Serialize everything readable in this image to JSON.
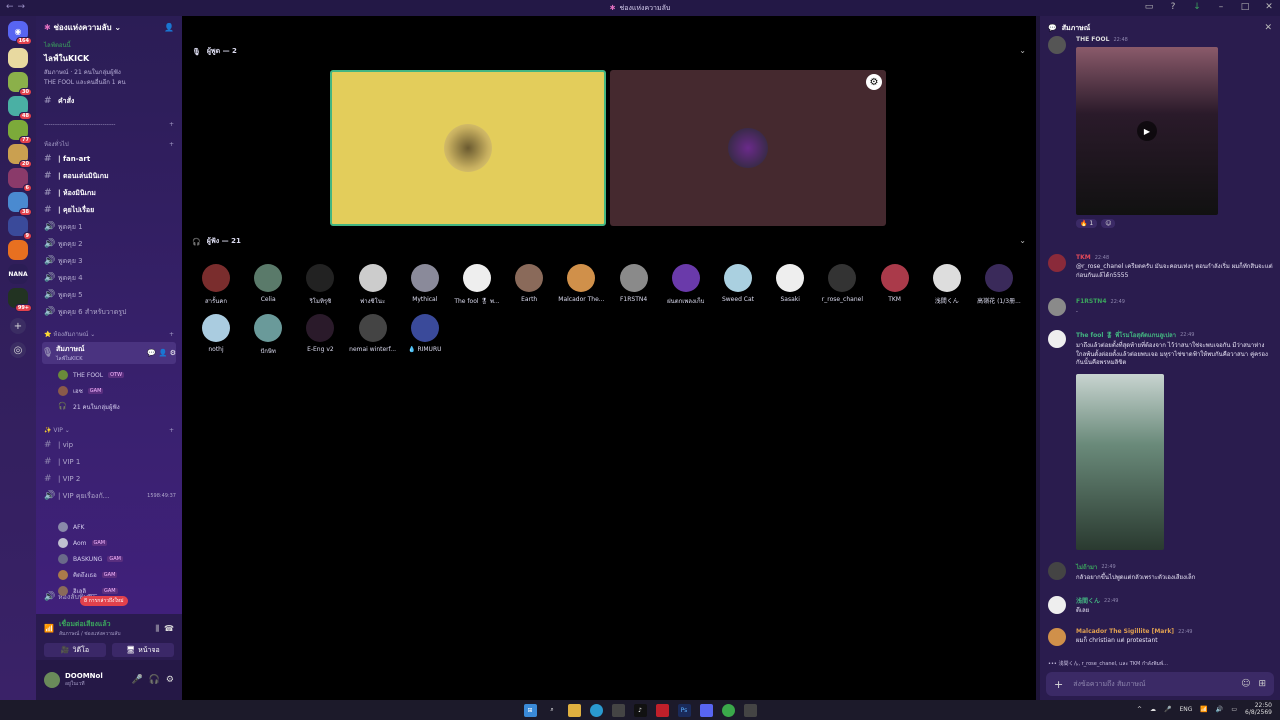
{
  "titlebar": {
    "title": "ช่องแห่งความลับ"
  },
  "rail": {
    "servers": [
      {
        "label": "",
        "badge": "164",
        "color": "#5865f2"
      },
      {
        "label": "",
        "badge": "",
        "color": "#e8d9a0"
      },
      {
        "label": "",
        "badge": "30",
        "color": "#8bb04a"
      },
      {
        "label": "",
        "badge": "48",
        "color": "#4ab0a4"
      },
      {
        "label": "",
        "badge": "77",
        "color": "#7caa3a"
      },
      {
        "label": "",
        "badge": "20",
        "color": "#caa050"
      },
      {
        "label": "",
        "badge": "6",
        "color": "#8a3a6a"
      },
      {
        "label": "",
        "badge": "38",
        "color": "#4a8ad0"
      },
      {
        "label": "",
        "badge": "9",
        "color": "#3a4a9a"
      },
      {
        "label": "",
        "badge": "",
        "color": "#e87020"
      },
      {
        "label": "NANA",
        "badge": "",
        "color": "#2b1d55"
      },
      {
        "label": "",
        "badge": "99+",
        "color": "#223322"
      }
    ]
  },
  "sidebar": {
    "server_name": "ช่องแห่งความลับ",
    "event": {
      "live": "ไลฟ์ตอนนี้",
      "title": "ไลฟ์ในKICK",
      "line1": "สัมภาษณ์ · 21 คนในกลุ่มผู้ฟัง",
      "line2": "THE FOOL และคนอื่นอีก 1 คน"
    },
    "top_channels": [
      {
        "name": "คำสั่ง"
      }
    ],
    "divider_label": "---------------------------------",
    "cat_general": "ห้องทั่วไป",
    "general": [
      {
        "name": "| fan-art"
      },
      {
        "name": "| ตอนเล่นมินิเกม"
      },
      {
        "name": "| ห้องมินิเกม"
      },
      {
        "name": "| คุยไปเรื่อย"
      },
      {
        "name": "พูดคุย 1"
      },
      {
        "name": "พูดคุย 2"
      },
      {
        "name": "พูดคุย 3"
      },
      {
        "name": "พูดคุย 4"
      },
      {
        "name": "พูดคุย 5"
      },
      {
        "name": "พูดคุย 6 สำหรับวาดรูป"
      }
    ],
    "cat_interview": "ห้องสัมภาษณ์",
    "interview": {
      "name": "สัมภาษณ์",
      "sub": "ไลฟ์ในKICK"
    },
    "interview_users": [
      {
        "name": "THE FOOL",
        "tag": "OTW"
      },
      {
        "name": "เฮซ",
        "tag": "GAM"
      },
      {
        "name": "21 คนในกลุ่มผู้ฟัง",
        "tag": ""
      }
    ],
    "cat_vip": "VIP",
    "vip": [
      {
        "name": "| vip"
      },
      {
        "name": "| VIP 1"
      },
      {
        "name": "| VIP 2"
      },
      {
        "name": "| VIP คุยเรื่องกั...",
        "time": "1598:49:37"
      }
    ],
    "vip_users": [
      {
        "name": "AFK",
        "tag": ""
      },
      {
        "name": "Aom",
        "tag": "GAM"
      },
      {
        "name": "BASKUNG",
        "tag": "GAM"
      },
      {
        "name": "คิดถึงเธอ",
        "tag": "GAM"
      },
      {
        "name": "ฮิเลลิ ___ ",
        "tag": "GAM"
      }
    ],
    "last_channel": "ห้องลับพิเศษ",
    "new_msgs": "8 การกล่าวถึงใหม่",
    "voice_panel": {
      "title": "เชื่อมต่อเสียงแล้ว",
      "sub": "สัมภาษณ์ / ช่องแห่งความลับ",
      "video": "วิดีโอ",
      "screen": "หน้าจอ"
    },
    "user": {
      "name": "DOOMNol",
      "status": "อยู่ในเวที"
    }
  },
  "stage": {
    "speakers_title": "ผู้พูด — 2",
    "listeners_title": "ผู้ฟัง — 21",
    "listeners": [
      {
        "name": "สารั้นคก",
        "color": "#7a2d2d"
      },
      {
        "name": "Celia",
        "color": "#5a7a6a"
      },
      {
        "name": "ริโมทิรุซิ",
        "color": "#222"
      },
      {
        "name": "ฟางชิโนะ",
        "color": "#ccc"
      },
      {
        "name": "Mythical",
        "color": "#8a8a9a"
      },
      {
        "name": "The fool 🎖 พ...",
        "color": "#eee"
      },
      {
        "name": "Earth",
        "color": "#8a6a5a"
      },
      {
        "name": "Malcador The...",
        "color": "#d0904a"
      },
      {
        "name": "F1RSTN4",
        "color": "#8a8a8a"
      },
      {
        "name": "ฝนตกเพลงเก็บ",
        "color": "#6a3aaa"
      },
      {
        "name": "Sweed Cat",
        "color": "#aad0e0"
      },
      {
        "name": "Sasaki",
        "color": "#eee"
      },
      {
        "name": "r_rose_chanel",
        "color": "#333"
      },
      {
        "name": "TKM",
        "color": "#aa3a4a"
      },
      {
        "name": "浅間くん",
        "color": "#ddd"
      },
      {
        "name": "高嶺花 (1/3册...",
        "color": "#3a2a5a"
      },
      {
        "name": "nothj",
        "color": "#aacce0"
      },
      {
        "name": "ปักษิท",
        "color": "#6a9a9a"
      },
      {
        "name": "E-Eng v2",
        "color": "#2a1a2a"
      },
      {
        "name": "nemai winterf...",
        "color": "#444"
      },
      {
        "name": "💧 RIMURU",
        "color": "#3a4a9a"
      }
    ]
  },
  "chat": {
    "title": "สัมภาษณ์",
    "top_name": "THE FOOL",
    "top_time": "22:48",
    "reaction_count": "1",
    "messages": [
      {
        "name": "TKM",
        "color": "#e34a5a",
        "time": "22:48",
        "text": "@r_rose_chanel เครียดครับ มันจะคอนเท่งๆ ตอนกำลังเริ่ม ผมก็ทักสินจะแต่ก่อนกันแล้ได้ก5555"
      },
      {
        "name": "F1RSTN4",
        "color": "#3ba55d",
        "time": "22:49",
        "text": "."
      },
      {
        "name": "The fool 🎖 พี่โรมโอสุตัดแกนลูเปลา",
        "color": "#43b581",
        "time": "22:49",
        "text": "มาถึงแล้วต่อยตั้งที่สุดท้ายที่ต้องจาก ไว้ว่าสนาใช่จะพบเจอกัน มีว่าสนาห่างใกลพ้นตั้งต่อยตั้งแล้วต่อยพบเจอ มหุราไช่ขาดฟ้าให้พบกันคือวาสนา คู่ครองกันนั้นคือพรหมลิขิต"
      },
      {
        "name": "ไม่ถ้ามา",
        "color": "#3ba55d",
        "time": "22:49",
        "text": "กลัวอยากขึ้นไปพูดแต่กลัวเพราะตัวเองเสียงเล็ก"
      },
      {
        "name": "浅間くん",
        "color": "#43b581",
        "time": "22:49",
        "text": "ดีเลย"
      },
      {
        "name": "Malcador The Sigillite [Mark]",
        "color": "#e0a050",
        "time": "22:49",
        "text": "ผมก็ christian แต่ protestant"
      }
    ],
    "typing": "浅間くん, r_rose_chanel, และ TKM กำลังพิมพ์...",
    "input_placeholder": "ส่งข้อความถึง สัมภาษณ์"
  },
  "taskbar": {
    "lang": "ENG",
    "time": "22:50",
    "date": "6/8/2569"
  }
}
